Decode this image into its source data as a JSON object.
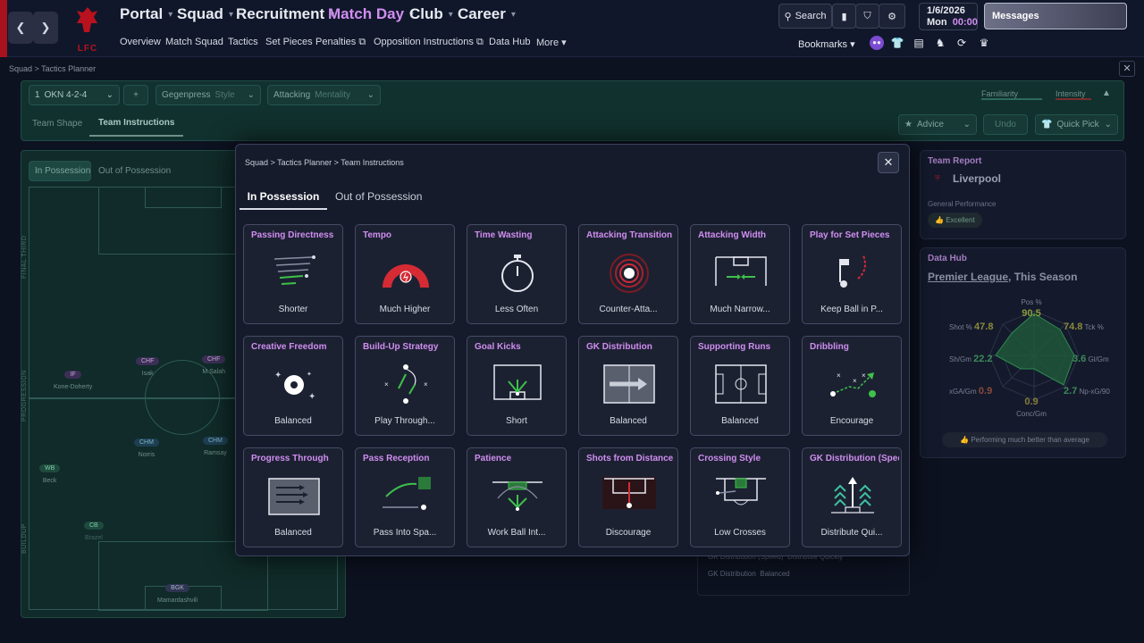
{
  "topbar": {
    "logo_text": "LFC",
    "menus": [
      "Portal",
      "Squad",
      "Recruitment",
      "Match Day",
      "Club",
      "Career"
    ],
    "submenu": [
      "Overview",
      "Match Squad",
      "Tactics",
      "Set Pieces",
      "Penalties",
      "Opposition Instructions",
      "Data Hub",
      "More"
    ],
    "search_label": "Search",
    "date": "1/6/2026",
    "day": "Mon",
    "time": "00:00",
    "messages_label": "Messages",
    "bookmarks_label": "Bookmarks"
  },
  "page": {
    "breadcrumb": [
      "Squad",
      "Tactics Planner"
    ],
    "formation": "OKN 4-2-4",
    "style_value": "Gegenpress",
    "style_label": "Style",
    "mentality_value": "Attacking",
    "mentality_label": "Mentality",
    "familiarity_label": "Familiarity",
    "intensity_label": "Intensity",
    "tabs": [
      "Team Shape",
      "Team Instructions"
    ],
    "advice_label": "Advice",
    "undo_label": "Undo",
    "quickpick_label": "Quick Pick",
    "phase_tabs": [
      "In Possession",
      "Out of Possession"
    ],
    "thirds": [
      "FINAL THIRD",
      "PROGRESSION",
      "BUILDUP"
    ],
    "players": [
      {
        "role": "IF",
        "name": "Kone-Doherty"
      },
      {
        "role": "CHF",
        "name": "Isak"
      },
      {
        "role": "CHF",
        "name": "M.Salah"
      },
      {
        "role": "CHM",
        "name": "Norris"
      },
      {
        "role": "CHM",
        "name": "Ramsay"
      },
      {
        "role": "WB",
        "name": "Beck"
      },
      {
        "role": "CB",
        "name": "Brazel"
      },
      {
        "role": "BGK",
        "name": "Mamardashvili"
      }
    ],
    "behind_rows": [
      {
        "label": "GK Distribution (Speed)",
        "value": "Distribute Quickly"
      },
      {
        "label": "GK Distribution",
        "value": "Balanced"
      }
    ]
  },
  "team_report": {
    "title": "Team Report",
    "team": "Liverpool",
    "general_label": "General Performance",
    "general_value": "Excellent"
  },
  "data_hub": {
    "title": "Data Hub",
    "league": "Premier League",
    "season": ", This Season",
    "stats": [
      {
        "label": "Pos %",
        "value": "90.5"
      },
      {
        "label": "Tck %",
        "value": "74.8"
      },
      {
        "label": "Gl/Gm",
        "value": "3.6"
      },
      {
        "label": "Np-xG/90",
        "value": "2.7"
      },
      {
        "label": "Conc/Gm",
        "value": "0.9"
      },
      {
        "label": "xGA/Gm",
        "value": "0.9"
      },
      {
        "label": "Sh/Gm",
        "value": "22.2"
      },
      {
        "label": "Shot %",
        "value": "47.8"
      }
    ],
    "summary": "Performing much better than average"
  },
  "modal": {
    "breadcrumb": [
      "Squad",
      "Tactics Planner",
      "Team Instructions"
    ],
    "tabs": [
      "In Possession",
      "Out of Possession"
    ],
    "tiles": [
      {
        "title": "Passing Directness",
        "value": "Shorter",
        "icon": "passing-directness-icon"
      },
      {
        "title": "Tempo",
        "value": "Much Higher",
        "icon": "tempo-gauge-icon"
      },
      {
        "title": "Time Wasting",
        "value": "Less Often",
        "icon": "stopwatch-icon"
      },
      {
        "title": "Attacking Transition",
        "value": "Counter-Atta...",
        "icon": "attacking-transition-icon"
      },
      {
        "title": "Attacking Width",
        "value": "Much Narrow...",
        "icon": "attacking-width-icon"
      },
      {
        "title": "Play for Set Pieces",
        "value": "Keep Ball in P...",
        "icon": "set-pieces-icon"
      },
      {
        "title": "Creative Freedom",
        "value": "Balanced",
        "icon": "creative-freedom-icon"
      },
      {
        "title": "Build-Up Strategy",
        "value": "Play Through...",
        "icon": "build-up-strategy-icon"
      },
      {
        "title": "Goal Kicks",
        "value": "Short",
        "icon": "goal-kicks-icon"
      },
      {
        "title": "GK Distribution",
        "value": "Balanced",
        "icon": "gk-distribution-icon"
      },
      {
        "title": "Supporting Runs",
        "value": "Balanced",
        "icon": "supporting-runs-icon"
      },
      {
        "title": "Dribbling",
        "value": "Encourage",
        "icon": "dribbling-icon"
      },
      {
        "title": "Progress Through",
        "value": "Balanced",
        "icon": "progress-through-icon"
      },
      {
        "title": "Pass Reception",
        "value": "Pass Into Spa...",
        "icon": "pass-reception-icon"
      },
      {
        "title": "Patience",
        "value": "Work Ball Int...",
        "icon": "patience-icon"
      },
      {
        "title": "Shots from Distance",
        "value": "Discourage",
        "icon": "shots-from-distance-icon"
      },
      {
        "title": "Crossing Style",
        "value": "Low Crosses",
        "icon": "crossing-style-icon"
      },
      {
        "title": "GK Distribution (Speed",
        "value": "Distribute Qui...",
        "icon": "gk-distribution-speed-icon"
      }
    ]
  },
  "colors": {
    "accent_purple": "#d08ef0",
    "brand_red": "#a8121f",
    "pitch_green": "#102b29"
  }
}
